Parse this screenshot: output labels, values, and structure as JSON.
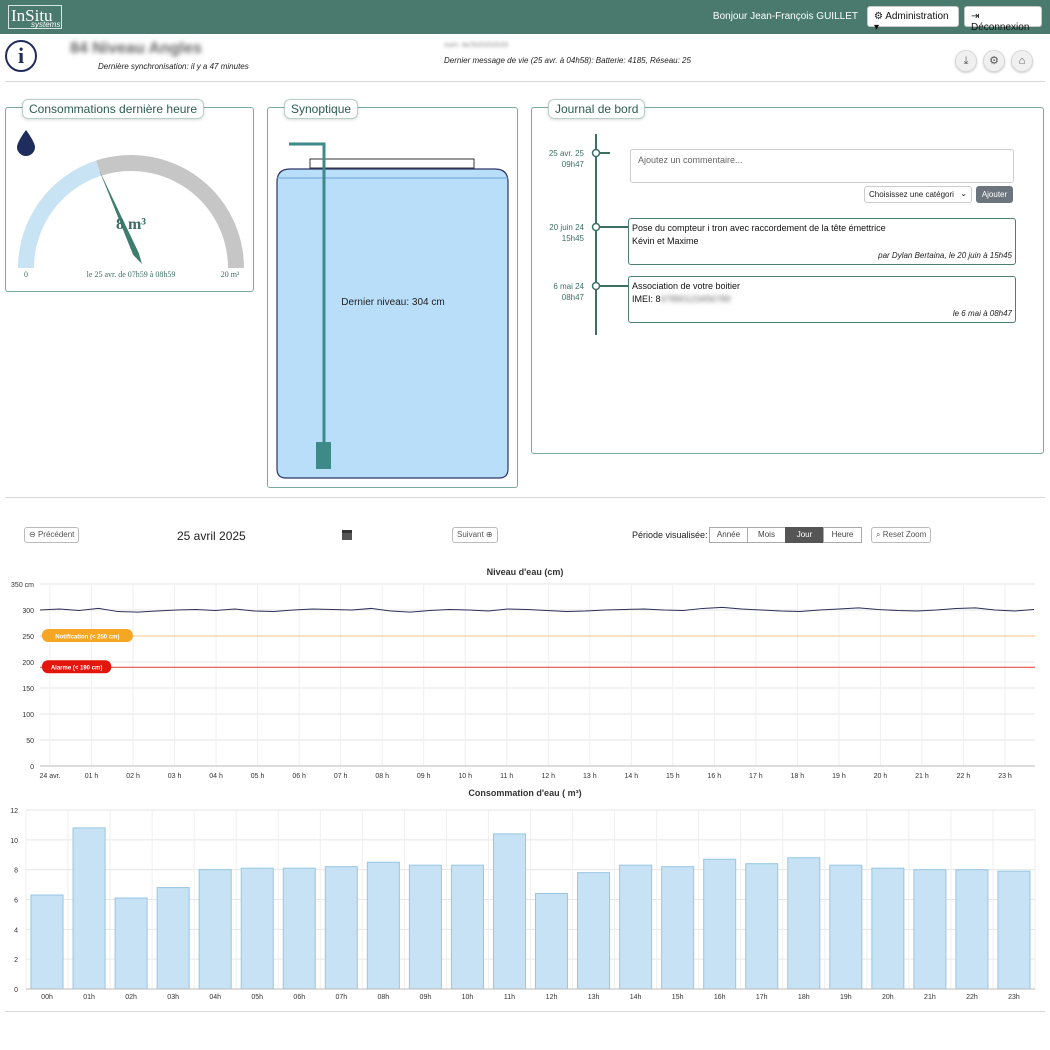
{
  "header": {
    "logo_main": "InSitu",
    "logo_sub": "systems",
    "greeting": "Bonjour Jean-François GUILLET",
    "admin_label": "Administration",
    "logout_label": "Déconnexion"
  },
  "device": {
    "name": "84 Niveau Angles",
    "sync": "Dernière synchronisation: il y a 47 minutes",
    "serial": "num: 4a7b20202020",
    "last_message": "Dernier message de vie (25 avr. à 04h58):  Batterie: 4185,   Réseau: 25"
  },
  "gauge": {
    "title": "Consommations dernière heure",
    "value_text": "8 m³",
    "value": 8,
    "max": 20,
    "min_label": "0",
    "max_label": "20  m³",
    "period": "le 25 avr. de 07h59 à 08h59",
    "colors": {
      "filled": "#c7e3f4",
      "empty": "#c6c6c6",
      "needle": "#3f7d6f"
    }
  },
  "synoptique": {
    "title": "Synoptique",
    "level_label": "Dernier niveau: 304 cm",
    "colors": {
      "water": "#b9defa",
      "pipe": "#3d8a88"
    }
  },
  "journal": {
    "title": "Journal de bord",
    "comment_placeholder": "Ajoutez un commentaire...",
    "category_placeholder": "Choisissez une catégori",
    "add_label": "Ajouter",
    "current_date": "25 avr. 25",
    "current_time": "09h47",
    "entries": [
      {
        "date": "20 juin 24",
        "time": "15h45",
        "title": "Pose du compteur i tron avec raccordement de la tête émettrice",
        "body": "Kévin et Maxime",
        "meta": "par Dylan Bertaina, le 20 juin à 15h45"
      },
      {
        "date": "6 mai 24",
        "time": "08h47",
        "title": "Association de votre boitier",
        "body": "IMEI: 8",
        "body_hidden": "67890123456789",
        "meta": "le 6 mai à 08h47"
      }
    ]
  },
  "controls": {
    "prev_label": "Précédent",
    "date": "25 avril 2025",
    "next_label": "Suivant",
    "period_label": "Période visualisée:",
    "periods": [
      "Année",
      "Mois",
      "Jour",
      "Heure"
    ],
    "active_period": "Jour",
    "reset_zoom": "Reset Zoom"
  },
  "chart_data": [
    {
      "type": "line",
      "title": "Niveau d'eau (cm)",
      "ylim": [
        0,
        350
      ],
      "yticks": [
        "0",
        "50",
        "100",
        "150",
        "200",
        "250",
        "300",
        "350 cm"
      ],
      "yvalues": [
        0,
        50,
        100,
        150,
        200,
        250,
        300,
        350
      ],
      "x": [
        "24 avr.",
        "01 h",
        "02 h",
        "03 h",
        "04 h",
        "05 h",
        "06 h",
        "07 h",
        "08 h",
        "09 h",
        "10 h",
        "11 h",
        "12 h",
        "13 h",
        "14 h",
        "15 h",
        "16 h",
        "17 h",
        "18 h",
        "19 h",
        "20 h",
        "21 h",
        "22 h",
        "23 h"
      ],
      "series": [
        {
          "values": [
            300,
            302,
            299,
            303,
            297,
            296,
            298,
            300,
            301,
            299,
            302,
            298,
            297,
            300,
            302,
            301,
            300,
            303,
            298,
            296,
            299,
            301,
            300,
            298,
            302,
            301,
            299,
            297,
            298,
            300,
            301,
            302,
            300,
            299,
            303,
            305,
            302,
            300,
            298,
            297,
            300,
            302,
            304,
            301,
            299,
            298,
            300,
            303,
            304,
            300,
            298,
            301
          ]
        }
      ],
      "thresholds": [
        {
          "label": "Notification (< 250 cm)",
          "value": 250,
          "color": "#f5a623",
          "line_color": "#f7c48a"
        },
        {
          "label": "Alarme (< 190 cm)",
          "value": 190,
          "color": "#e3160b",
          "line_color": "#e53b2e"
        }
      ],
      "line_color": "#2c2f57",
      "grid": true
    },
    {
      "type": "bar",
      "title": "Consommation d'eau ( m³)",
      "ylim": [
        0,
        12
      ],
      "yticks": [
        "0",
        "2",
        "4",
        "6",
        "8",
        "10",
        "12"
      ],
      "yvalues": [
        0,
        2,
        4,
        6,
        8,
        10,
        12
      ],
      "categories": [
        "00h",
        "01h",
        "02h",
        "03h",
        "04h",
        "05h",
        "06h",
        "07h",
        "08h",
        "09h",
        "10h",
        "11h",
        "12h",
        "13h",
        "14h",
        "15h",
        "16h",
        "17h",
        "18h",
        "19h",
        "20h",
        "21h",
        "22h",
        "23h"
      ],
      "values": [
        6.3,
        10.8,
        6.1,
        6.8,
        8.0,
        8.1,
        8.1,
        8.2,
        8.5,
        8.3,
        8.3,
        10.4,
        6.4,
        7.8,
        8.3,
        8.2,
        8.7,
        8.4,
        8.8,
        8.3,
        8.1,
        8.0,
        8.0,
        7.9
      ],
      "bar_color": "#c6e2f4",
      "bar_border": "#97c7e3",
      "grid": true
    }
  ]
}
